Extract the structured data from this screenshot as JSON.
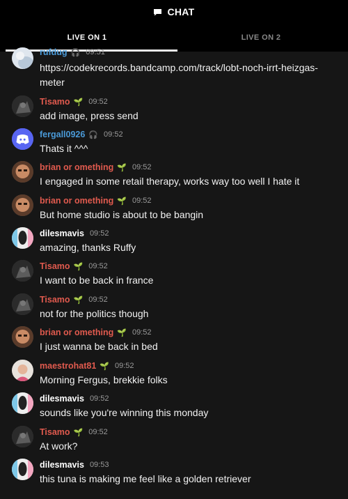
{
  "header": {
    "title": "CHAT",
    "icon": "chat-bubble-icon"
  },
  "tabs": [
    {
      "label": "LIVE ON 1",
      "active": true
    },
    {
      "label": "LIVE ON 2",
      "active": false
    }
  ],
  "messages": [
    {
      "user": "rufdug",
      "badge": "headphone",
      "time": "09:51",
      "text": "https://codekrecords.bandcamp.com/track/lobt-noch-irrt-heizgas-meter"
    },
    {
      "user": "Tisamo",
      "badge": "sprout",
      "time": "09:52",
      "text": "add image, press send"
    },
    {
      "user": "fergall0926",
      "badge": "headphone",
      "time": "09:52",
      "text": "Thats it ^^^"
    },
    {
      "user": "brian or omething",
      "badge": "sprout",
      "time": "09:52",
      "text": "I engaged in some retail therapy, works way too well I hate it"
    },
    {
      "user": "brian or omething",
      "badge": "sprout",
      "time": "09:52",
      "text": "But home studio is about to be bangin"
    },
    {
      "user": "dilesmavis",
      "badge": "",
      "time": "09:52",
      "text": "amazing, thanks Ruffy"
    },
    {
      "user": "Tisamo",
      "badge": "sprout",
      "time": "09:52",
      "text": "I want to be back in france"
    },
    {
      "user": "Tisamo",
      "badge": "sprout",
      "time": "09:52",
      "text": "not for the politics though"
    },
    {
      "user": "brian or omething",
      "badge": "sprout",
      "time": "09:52",
      "text": "I just wanna be back in bed"
    },
    {
      "user": "maestrohat81",
      "badge": "sprout",
      "time": "09:52",
      "text": "Morning Fergus, brekkie folks"
    },
    {
      "user": "dilesmavis",
      "badge": "",
      "time": "09:52",
      "text": "sounds like you're winning this monday"
    },
    {
      "user": "Tisamo",
      "badge": "sprout",
      "time": "09:52",
      "text": "At work?"
    },
    {
      "user": "dilesmavis",
      "badge": "",
      "time": "09:53",
      "text": "this tuna is making me feel like a golden retriever"
    }
  ],
  "colors": {
    "red_user": "#e05a4e",
    "blue_user": "#4a9ad8",
    "sprout": "#6dbb3a",
    "background": "#161616"
  }
}
